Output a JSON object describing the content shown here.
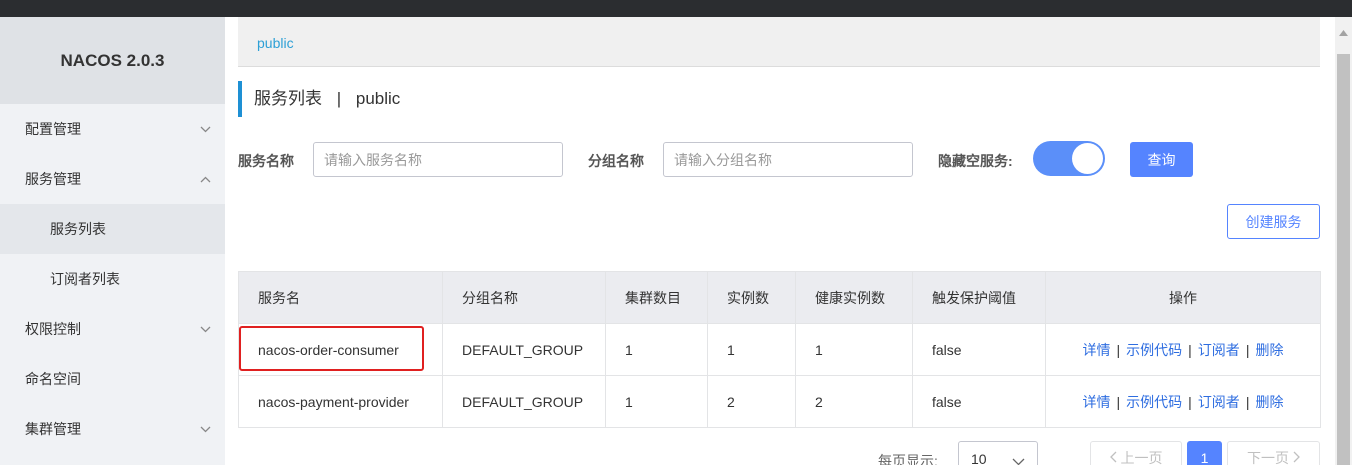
{
  "sidebar": {
    "brand": "NACOS 2.0.3",
    "items": [
      {
        "label": "配置管理",
        "chevron": "down"
      },
      {
        "label": "服务管理",
        "chevron": "up"
      },
      {
        "label": "服务列表",
        "sub": true,
        "active": true
      },
      {
        "label": "订阅者列表",
        "sub": true
      },
      {
        "label": "权限控制",
        "chevron": "down"
      },
      {
        "label": "命名空间"
      },
      {
        "label": "集群管理",
        "chevron": "down"
      }
    ]
  },
  "breadcrumb": {
    "namespace": "public"
  },
  "page": {
    "title": "服务列表",
    "separator": "|",
    "namespace": "public"
  },
  "filters": {
    "service_name_label": "服务名称",
    "service_name_placeholder": "请输入服务名称",
    "group_name_label": "分组名称",
    "group_name_placeholder": "请输入分组名称",
    "hide_empty_label": "隐藏空服务:",
    "hide_empty_on": true,
    "query_button": "查询"
  },
  "create_button": "创建服务",
  "table": {
    "columns": [
      "服务名",
      "分组名称",
      "集群数目",
      "实例数",
      "健康实例数",
      "触发保护阈值",
      "操作"
    ],
    "rows": [
      {
        "name": "nacos-order-consumer",
        "group": "DEFAULT_GROUP",
        "clusters": "1",
        "instances": "1",
        "healthy": "1",
        "threshold": "false"
      },
      {
        "name": "nacos-payment-provider",
        "group": "DEFAULT_GROUP",
        "clusters": "1",
        "instances": "2",
        "healthy": "2",
        "threshold": "false"
      }
    ],
    "actions": {
      "detail": "详情",
      "sample_code": "示例代码",
      "subscribers": "订阅者",
      "delete": "删除",
      "sep": "|"
    }
  },
  "pagination": {
    "per_page_label": "每页显示:",
    "per_page_value": "10",
    "prev": "上一页",
    "current": "1",
    "next": "下一页"
  },
  "colors": {
    "primary": "#5584ff",
    "link": "#2e6de0",
    "highlight": "#e02020",
    "accent_bar": "#1e90d4"
  }
}
